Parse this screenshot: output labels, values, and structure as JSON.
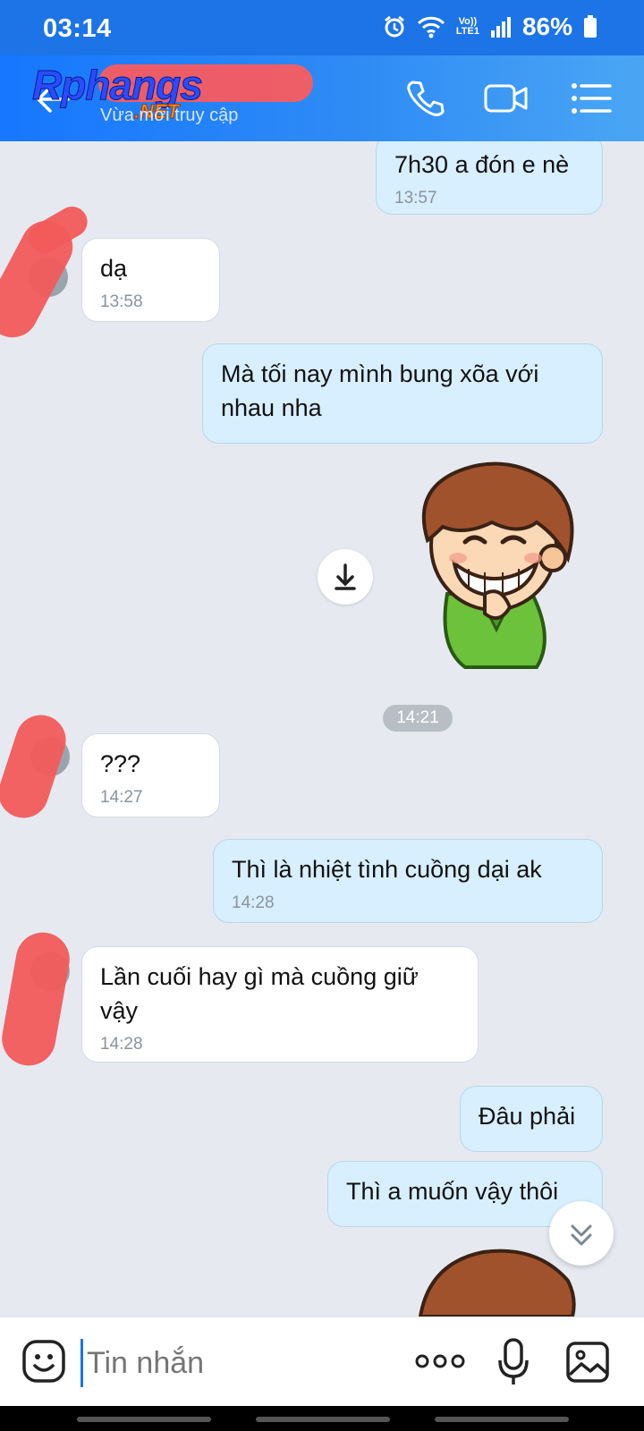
{
  "status_bar": {
    "time": "03:14",
    "battery": "86%",
    "network_top": "Vo))",
    "network_bottom": "LTE1"
  },
  "header": {
    "watermark": "Rphangs",
    "watermark_suffix": ".NET",
    "contact_status": "Vừa mới truy cập",
    "icons": [
      "back-arrow-icon",
      "phone-icon",
      "video-camera-icon",
      "menu-list-icon"
    ]
  },
  "messages": [
    {
      "dir": "out",
      "text": "7h30 a đón e nè",
      "time": "13:57"
    },
    {
      "dir": "in",
      "text": "dạ",
      "time": "13:58"
    },
    {
      "dir": "out",
      "text": "Mà tối nay mình bung xõa với nhau nha",
      "time": ""
    },
    {
      "dir": "out",
      "type": "sticker",
      "icon": "download-icon"
    },
    {
      "dir": "in",
      "text": "???",
      "time": "14:27"
    },
    {
      "dir": "out",
      "text": "Thì là nhiệt tình cuồng dại ak",
      "time": "14:28"
    },
    {
      "dir": "in",
      "text": "Lần cuối hay gì mà cuồng giữ vậy",
      "time": "14:28"
    },
    {
      "dir": "out",
      "text": "Đâu phải",
      "time": ""
    },
    {
      "dir": "out",
      "text": "Thì a muốn vậy thôi",
      "time": ""
    }
  ],
  "time_divider": "14:21",
  "input_bar": {
    "placeholder": "Tin nhắn",
    "icons": [
      "emoji-icon",
      "more-dots-icon",
      "microphone-icon",
      "image-icon"
    ]
  },
  "colors": {
    "accent": "#1c74e6",
    "outgoing_bubble": "#d7efff",
    "incoming_bubble": "#ffffff",
    "redaction": "#f25b5b"
  }
}
